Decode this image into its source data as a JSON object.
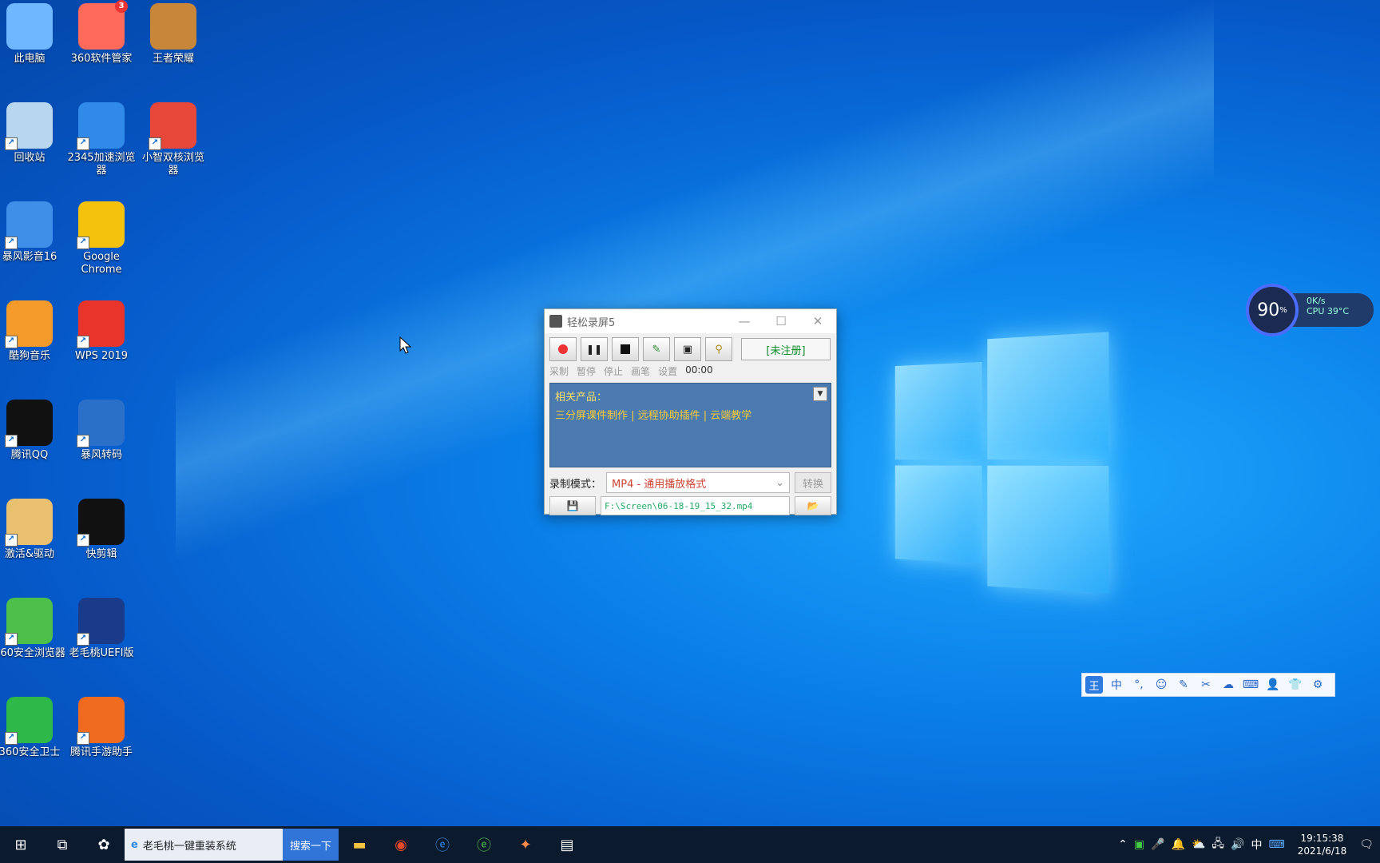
{
  "desktop_icons": [
    {
      "label": "此电脑",
      "icon": "computer-icon",
      "color": "#6fb7ff"
    },
    {
      "label": "360软件管家",
      "icon": "app-store-icon",
      "color": "#ff6a5a",
      "badge": "3"
    },
    {
      "label": "王者荣耀",
      "icon": "game-icon",
      "color": "#c8863a"
    },
    {
      "label": "回收站",
      "icon": "recycle-bin-icon",
      "color": "#b9d6ef"
    },
    {
      "label": "2345加速浏览器",
      "icon": "ie-browser-icon",
      "color": "#2f8ae8"
    },
    {
      "label": "小智双核浏览器",
      "icon": "edge-browser-icon",
      "color": "#e8483a"
    },
    {
      "label": "暴风影音16",
      "icon": "media-icon",
      "color": "#3d8fe8"
    },
    {
      "label": "Google Chrome",
      "icon": "chrome-icon",
      "color": "#f4c20d"
    },
    {
      "label": "酷狗音乐",
      "icon": "music-icon",
      "color": "#f39a2a"
    },
    {
      "label": "WPS 2019",
      "icon": "wps-icon",
      "color": "#e8342a"
    },
    {
      "label": "腾讯QQ",
      "icon": "qq-icon",
      "color": "#111111"
    },
    {
      "label": "暴风转码",
      "icon": "video-convert-icon",
      "color": "#2a70c8"
    },
    {
      "label": "激活&驱动",
      "icon": "driver-icon",
      "color": "#e8c070"
    },
    {
      "label": "快剪辑",
      "icon": "video-edit-icon",
      "color": "#111111"
    },
    {
      "label": "360安全浏览器",
      "icon": "360-browser-icon",
      "color": "#4cc04a"
    },
    {
      "label": "老毛桃UEFI版",
      "icon": "uefi-icon",
      "color": "#1a3a8a"
    },
    {
      "label": "360安全卫士",
      "icon": "360-guard-icon",
      "color": "#2fb84a"
    },
    {
      "label": "腾讯手游助手",
      "icon": "game-assistant-icon",
      "color": "#f06a20"
    }
  ],
  "recorder": {
    "title": "轻松录屏5",
    "status": "[未注册]",
    "labels": [
      "采制",
      "暂停",
      "停止",
      "画笔",
      "设置"
    ],
    "time": "00:00",
    "ad_heading": "相关产品：",
    "ad_links": "三分屏课件制作 | 远程协助插件 | 云端教学",
    "mode_label": "录制模式：",
    "mode_value": "MP4 - 通用播放格式",
    "convert_label": "转换",
    "path": "F:\\Screen\\06-18-19_15_32.mp4",
    "save_label": "💾",
    "open_label": "📂"
  },
  "cpu_widget": {
    "value": "90",
    "unit": "%",
    "net": "0K/s",
    "temp": "CPU 39°C"
  },
  "ime_bar": {
    "logo": "王",
    "items": [
      "中",
      "°,",
      "☺",
      "✎",
      "✂",
      "☁",
      "⌨",
      "👤",
      "👕",
      "⚙"
    ]
  },
  "taskbar": {
    "active_task": "老毛桃一键重装系统",
    "search_button": "搜索一下",
    "tray_lang": "中",
    "time": "19:15:38",
    "date": "2021/6/18"
  }
}
